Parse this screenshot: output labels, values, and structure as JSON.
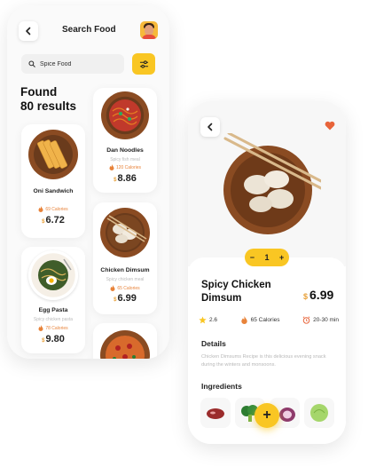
{
  "left_screen": {
    "title": "Search Food",
    "search": {
      "value": "Spice Food",
      "placeholder": ""
    },
    "found_line1": "Found",
    "found_line2": "80 results",
    "cards": [
      {
        "name": "Oni Sandwich",
        "desc": "",
        "calories": "69 Calories",
        "currency": "$",
        "price": "6.72"
      },
      {
        "name": "Dan Noodles",
        "desc": "Spicy fish meal",
        "calories": "120 Calories",
        "currency": "$",
        "price": "8.86"
      },
      {
        "name": "Chicken Dimsum",
        "desc": "Spicy chicken meal",
        "calories": "65 Calories",
        "currency": "$",
        "price": "6.99"
      },
      {
        "name": "Egg Pasta",
        "desc": "Spicy chicken pasta",
        "calories": "78 Calories",
        "currency": "$",
        "price": "9.80"
      }
    ]
  },
  "right_screen": {
    "counter": {
      "minus": "−",
      "value": "1",
      "plus": "+"
    },
    "dish_name": "Spicy Chicken Dimsum",
    "currency": "$",
    "price": "6.99",
    "stats": {
      "rating": "2.6",
      "calories": "65 Calories",
      "time": "20-30 min"
    },
    "details_heading": "Details",
    "details_text": "Chicken Dimsums Recipe is this delicious evening snack during the winters and monsoons.",
    "ingredients_heading": "Ingredients",
    "add_label": "+"
  },
  "colors": {
    "accent": "#f9c623",
    "price": "#e8a13a",
    "flame": "#e8833a",
    "heart": "#e8643a"
  }
}
